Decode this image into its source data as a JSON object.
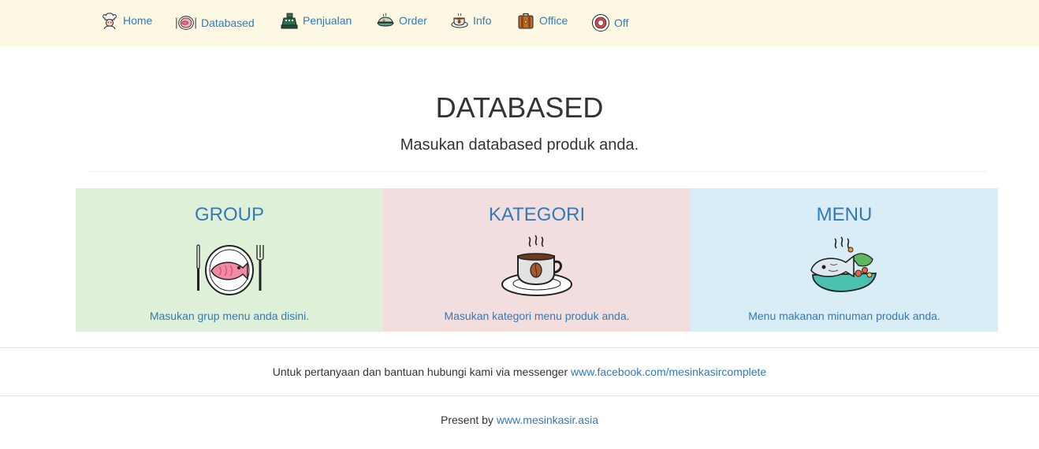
{
  "nav": {
    "items": [
      {
        "label": "Home",
        "icon": "chef-icon"
      },
      {
        "label": "Databased",
        "icon": "fish-plate-icon"
      },
      {
        "label": "Penjualan",
        "icon": "cash-register-icon"
      },
      {
        "label": "Order",
        "icon": "food-tray-icon"
      },
      {
        "label": "Info",
        "icon": "coffee-cup-icon"
      },
      {
        "label": "Office",
        "icon": "briefcase-icon"
      },
      {
        "label": "Off",
        "icon": "power-icon"
      }
    ]
  },
  "header": {
    "title": "DATABASED",
    "subtitle": "Masukan databased produk anda."
  },
  "panels": [
    {
      "title": "GROUP",
      "description": "Masukan grup menu anda disini.",
      "icon": "fish-plate-icon",
      "background": "#dff0d8"
    },
    {
      "title": "KATEGORI",
      "description": "Masukan kategori menu produk anda.",
      "icon": "coffee-cup-icon",
      "background": "#f2dede"
    },
    {
      "title": "MENU",
      "description": "Menu makanan minuman produk anda.",
      "icon": "fish-dish-icon",
      "background": "#d9edf7"
    }
  ],
  "footer": {
    "contact_text": "Untuk pertanyaan dan bantuan hubungi kami via messenger",
    "contact_link": "www.facebook.com/mesinkasircomplete",
    "present_text": "Present by",
    "present_link": "www.mesinkasir.asia"
  },
  "colors": {
    "link": "#337ab7",
    "navbar_bg": "#fcf8e3"
  }
}
